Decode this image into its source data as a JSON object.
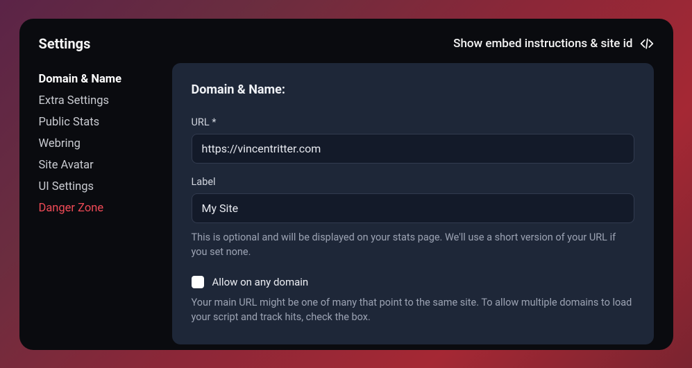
{
  "header": {
    "title": "Settings",
    "embed_link": "Show embed instructions & site id"
  },
  "sidebar": {
    "items": [
      {
        "label": "Domain & Name",
        "state": "active"
      },
      {
        "label": "Extra Settings",
        "state": "normal"
      },
      {
        "label": "Public Stats",
        "state": "normal"
      },
      {
        "label": "Webring",
        "state": "normal"
      },
      {
        "label": "Site Avatar",
        "state": "normal"
      },
      {
        "label": "UI Settings",
        "state": "normal"
      },
      {
        "label": "Danger Zone",
        "state": "danger"
      }
    ]
  },
  "content": {
    "section_title": "Domain & Name:",
    "url": {
      "label": "URL *",
      "value": "https://vincentritter.com"
    },
    "label_field": {
      "label": "Label",
      "value": "My Site",
      "help": "This is optional and will be displayed on your stats page. We'll use a short version of your URL if you set none."
    },
    "allow_any": {
      "label": "Allow on any domain",
      "help": "Your main URL might be one of many that point to the same site. To allow multiple domains to load your script and track hits, check the box."
    }
  }
}
